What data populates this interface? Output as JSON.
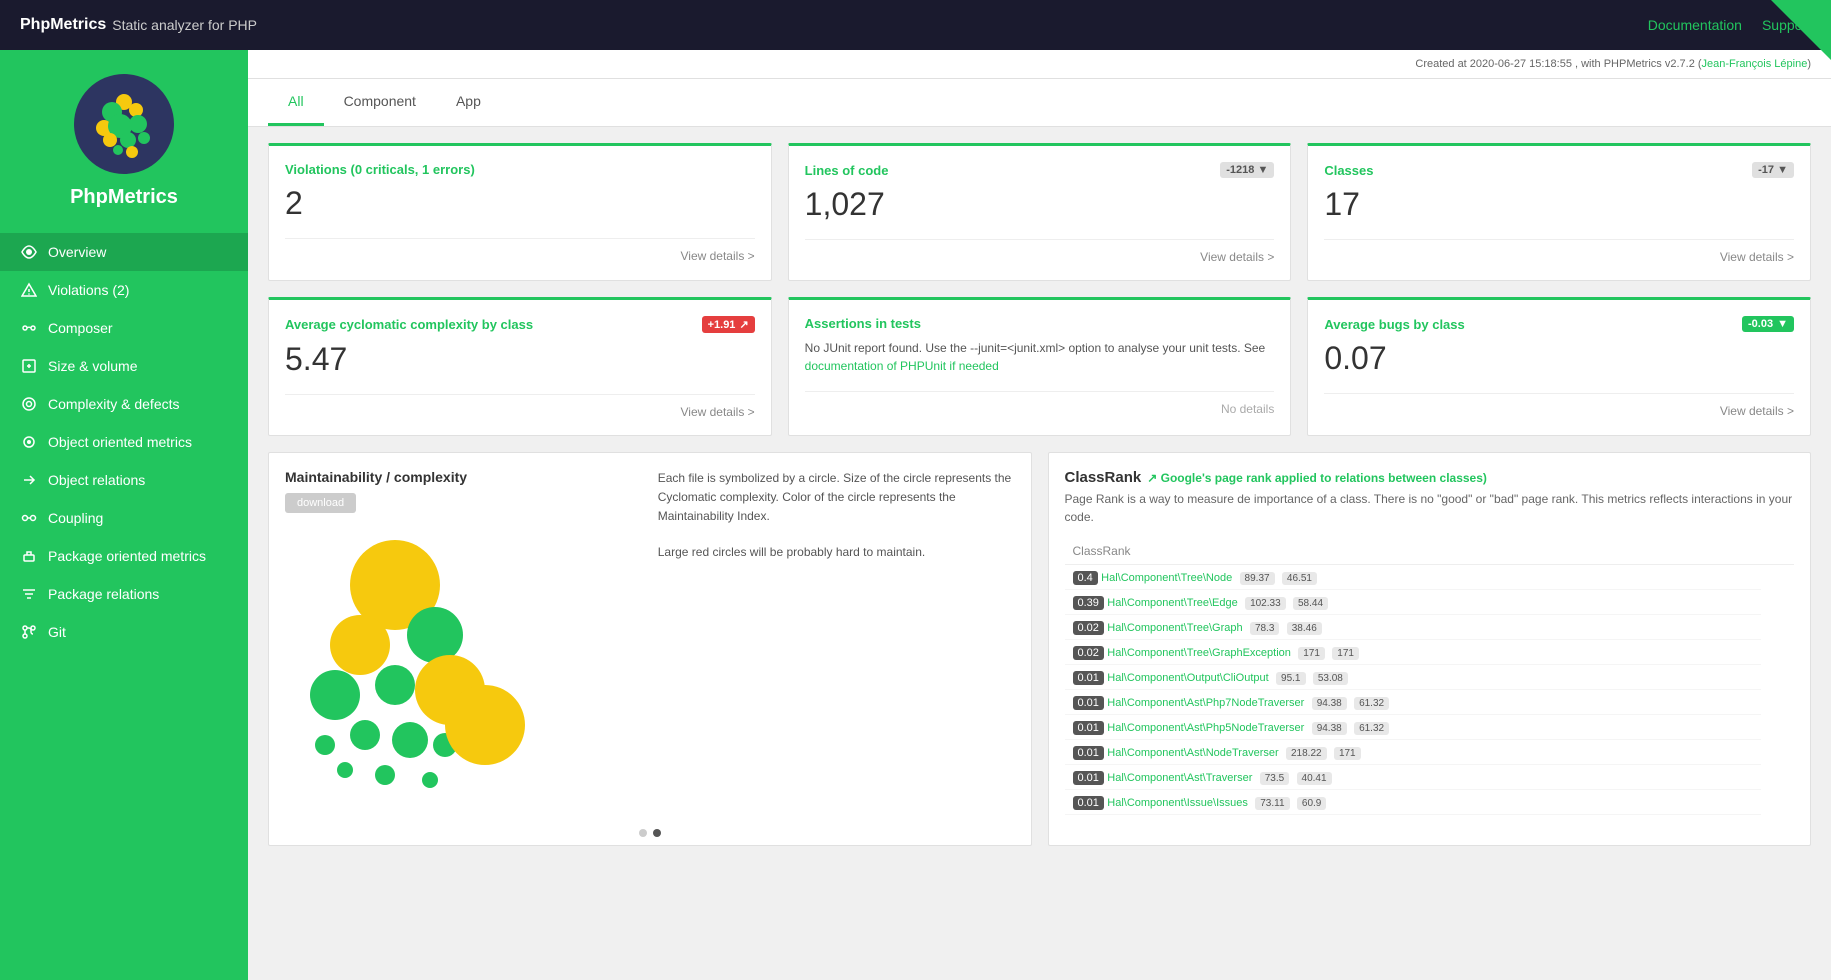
{
  "topbar": {
    "brand_bold": "PhpMetrics",
    "brand_sub": "Static analyzer for PHP",
    "documentation": "Documentation",
    "support": "Support"
  },
  "header_info": "Created at 2020-06-27 15:18:55 , with PHPMetrics v2.7.2 (",
  "header_link": "Jean-François Lépine",
  "header_info_end": ")",
  "sidebar": {
    "title": "PhpMetrics",
    "items": [
      {
        "id": "overview",
        "label": "Overview",
        "icon": "eye"
      },
      {
        "id": "violations",
        "label": "Violations (2)",
        "icon": "warning"
      },
      {
        "id": "composer",
        "label": "Composer",
        "icon": "link"
      },
      {
        "id": "size-volume",
        "label": "Size & volume",
        "icon": "resize"
      },
      {
        "id": "complexity-defects",
        "label": "Complexity & defects",
        "icon": "chart"
      },
      {
        "id": "object-oriented",
        "label": "Object oriented metrics",
        "icon": "object"
      },
      {
        "id": "object-relations",
        "label": "Object relations",
        "icon": "relations"
      },
      {
        "id": "coupling",
        "label": "Coupling",
        "icon": "coupling"
      },
      {
        "id": "package-oriented",
        "label": "Package oriented metrics",
        "icon": "package"
      },
      {
        "id": "package-relations",
        "label": "Package relations",
        "icon": "pkg-rel"
      },
      {
        "id": "git",
        "label": "Git",
        "icon": "git"
      }
    ]
  },
  "tabs": [
    {
      "id": "all",
      "label": "All",
      "active": true
    },
    {
      "id": "component",
      "label": "Component"
    },
    {
      "id": "app",
      "label": "App"
    }
  ],
  "cards": {
    "violations": {
      "title": "Violations (0 criticals, 1 errors)",
      "value": "2",
      "link": "View details >"
    },
    "lines_of_code": {
      "title": "Lines of code",
      "value": "1,027",
      "badge": "-1218",
      "link": "View details >"
    },
    "classes": {
      "title": "Classes",
      "value": "17",
      "badge": "-17",
      "link": "View details >"
    },
    "avg_cyclomatic": {
      "title": "Average cyclomatic complexity by class",
      "value": "5.47",
      "badge": "+1.91",
      "link": "View details >"
    },
    "assertions": {
      "title": "Assertions in tests",
      "note1": "No JUnit report found. Use the --junit=<junit.xml> option to analyse your unit tests. See",
      "note_link": "documentation of PHPUnit if needed",
      "no_details": "No details"
    },
    "avg_bugs": {
      "title": "Average bugs by class",
      "value": "0.07",
      "badge": "-0.03",
      "link": "View details >"
    }
  },
  "maintainability": {
    "title": "Maintainability / complexity",
    "download_label": "download",
    "description1": "Each file is symbolized by a circle. Size of the circle represents the Cyclomatic complexity. Color of the circle represents the Maintainability Index.",
    "description2": "Large red circles will be probably hard to maintain.",
    "dots": [
      false,
      true
    ]
  },
  "classrank": {
    "title": "ClassRank",
    "ext_label": "↗ Google's page rank applied to relations between classes)",
    "subtitle": "Page Rank is a way to measure de importance of a class. There is no \"good\" or \"bad\" page rank. This metrics reflects interactions in your code.",
    "col_header": "ClassRank",
    "rows": [
      {
        "rank": "0.4",
        "name": "Hal\\Component\\Tree\\Node",
        "val1": "89.37",
        "val2": "46.51"
      },
      {
        "rank": "0.39",
        "name": "Hal\\Component\\Tree\\Edge",
        "val1": "102.33",
        "val2": "58.44"
      },
      {
        "rank": "0.02",
        "name": "Hal\\Component\\Tree\\Graph",
        "val1": "78.3",
        "val2": "38.46"
      },
      {
        "rank": "0.02",
        "name": "Hal\\Component\\Tree\\GraphException",
        "val1": "171",
        "val2": "171"
      },
      {
        "rank": "0.01",
        "name": "Hal\\Component\\Output\\CliOutput",
        "val1": "95.1",
        "val2": "53.08"
      },
      {
        "rank": "0.01",
        "name": "Hal\\Component\\Ast\\Php7NodeTraverser",
        "val1": "94.38",
        "val2": "61.32"
      },
      {
        "rank": "0.01",
        "name": "Hal\\Component\\Ast\\Php5NodeTraverser",
        "val1": "94.38",
        "val2": "61.32"
      },
      {
        "rank": "0.01",
        "name": "Hal\\Component\\Ast\\NodeTraverser",
        "val1": "218.22",
        "val2": "171"
      },
      {
        "rank": "0.01",
        "name": "Hal\\Component\\Ast\\Traverser",
        "val1": "73.5",
        "val2": "40.41"
      },
      {
        "rank": "0.01",
        "name": "Hal\\Component\\Issue\\Issues",
        "val1": "73.11",
        "val2": "60.9"
      }
    ]
  }
}
